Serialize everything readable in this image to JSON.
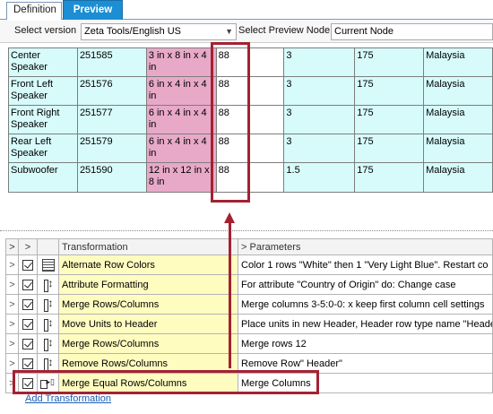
{
  "tabs": [
    {
      "label": "Definition",
      "active": false
    },
    {
      "label": "Preview",
      "active": true
    }
  ],
  "toolbar": {
    "select_version_label": "Select version",
    "version_value": "Zeta Tools/English US",
    "preview_node_label": "Select Preview Node",
    "preview_node_value": "Current Node"
  },
  "preview_rows": [
    [
      "Center Speaker",
      "251585",
      "3 in x 8 in x 4 in",
      "88",
      "3",
      "175",
      "Malaysia"
    ],
    [
      "Front Left Speaker",
      "251576",
      "6 in x 4 in x 4 in",
      "88",
      "3",
      "175",
      "Malaysia"
    ],
    [
      "Front Right Speaker",
      "251577",
      "6 in x 4 in x 4 in",
      "88",
      "3",
      "175",
      "Malaysia"
    ],
    [
      "Rear Left Speaker",
      "251579",
      "6 in x 4 in x 4 in",
      "88",
      "3",
      "175",
      "Malaysia"
    ],
    [
      "Subwoofer",
      "251590",
      "12 in x 12 in x 8 in",
      "88",
      "1.5",
      "175",
      "Malaysia"
    ]
  ],
  "grid": {
    "header": {
      "expand": ">",
      "col2": ">",
      "transformation": "Transformation",
      "params_expand": ">",
      "parameters": "Parameters"
    },
    "rows": [
      {
        "expand": ">",
        "icon": "alternate-rows-icon",
        "name": "Alternate Row Colors",
        "params": "Color 1 rows \"White\" then 1 \"Very Light Blue\".  Restart co"
      },
      {
        "expand": ">",
        "icon": "attribute-format-icon",
        "name": "Attribute Formatting",
        "params": "For attribute \"Country of Origin\" do: Change case"
      },
      {
        "expand": ">",
        "icon": "merge-rows-icon",
        "name": "Merge Rows/Columns",
        "params": "Merge columns 3-5:0-0: x  keep first column cell settings"
      },
      {
        "expand": ">",
        "icon": "move-units-icon",
        "name": "Move Units to Header",
        "params": "Place units in new Header, Header row type name \"Heade"
      },
      {
        "expand": ">",
        "icon": "merge-rows-icon",
        "name": "Merge Rows/Columns",
        "params": "Merge rows 12"
      },
      {
        "expand": ">",
        "icon": "remove-rows-icon",
        "name": "Remove Rows/Columns",
        "params": "Remove Row\" Header\""
      },
      {
        "expand": ">",
        "icon": "merge-equal-icon",
        "name": "Merge Equal Rows/Columns",
        "params": "Merge Columns"
      }
    ]
  },
  "add_transformation": "Add Transformation",
  "colors": {
    "highlight": "#a32232",
    "preview_bg": "#d7fbfb",
    "dimension_bg": "#e8a9c9",
    "name_bg": "#fffcc0",
    "tab_active": "#1c8ed3"
  }
}
